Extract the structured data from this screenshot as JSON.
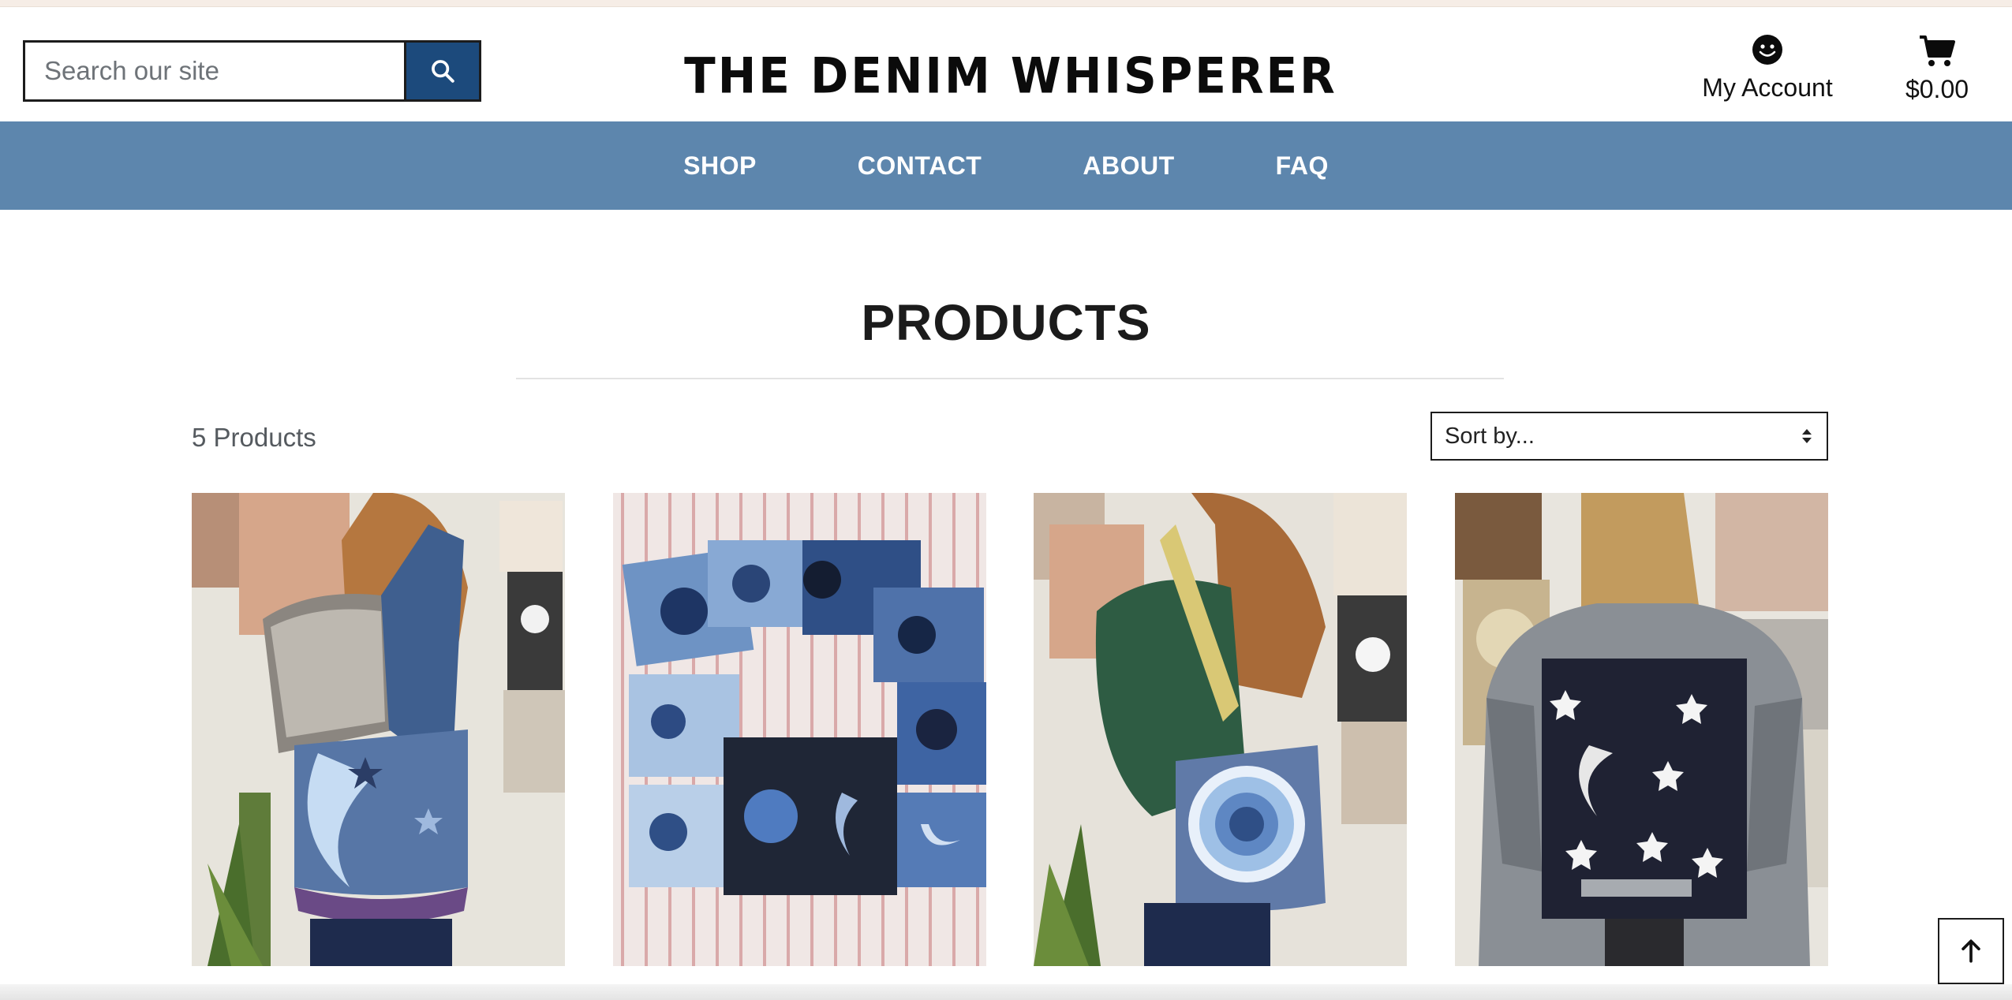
{
  "header": {
    "search": {
      "placeholder": "Search our site",
      "value": ""
    },
    "search_icon": "search-icon",
    "logo_text": "THE DENIM WHISPERER",
    "account": {
      "label": "My Account",
      "icon": "user-smiley-icon"
    },
    "cart": {
      "label": "$0.00",
      "icon": "cart-icon"
    }
  },
  "nav": {
    "items": [
      {
        "label": "SHOP"
      },
      {
        "label": "CONTACT"
      },
      {
        "label": "ABOUT"
      },
      {
        "label": "FAQ"
      }
    ]
  },
  "main": {
    "title": "PRODUCTS",
    "count": "5 Products",
    "sort": {
      "selected": "Sort by..."
    }
  },
  "products": [
    {
      "image": "denim-tote-with-embroidered-crescent-moon"
    },
    {
      "image": "denim-shorts-embroidered-suns"
    },
    {
      "image": "denim-tote-with-embroidered-sun"
    },
    {
      "image": "grey-denim-jacket-with-moon-and-stars-panel"
    }
  ],
  "colors": {
    "nav_bg": "#5d86ad",
    "search_button": "#1c4a7c",
    "text": "#1b1b1b"
  },
  "back_to_top_icon": "arrow-up-icon"
}
